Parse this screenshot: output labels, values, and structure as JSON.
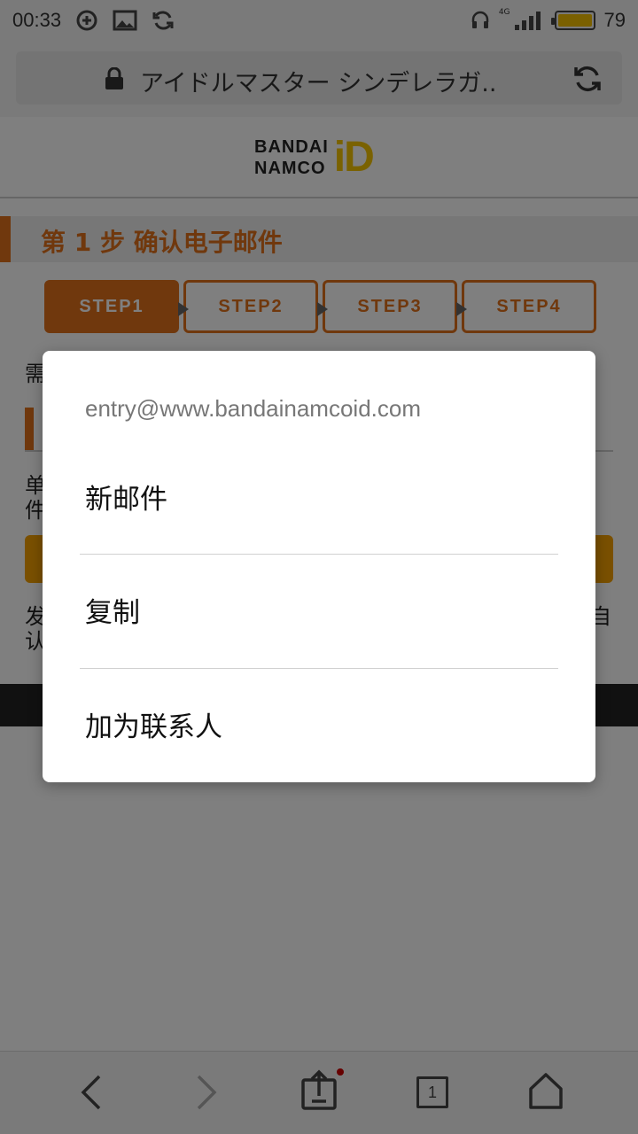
{
  "status_bar": {
    "time": "00:33",
    "network_type": "4G",
    "battery": "79",
    "battery_color": "#f5c000"
  },
  "url_bar": {
    "title": "アイドルマスター シンデレラガ.."
  },
  "logo": {
    "line1": "BANDAI",
    "line2": "NAMCO",
    "mark": "iD",
    "mark_color": "#f5c400"
  },
  "page": {
    "step_heading": "第 1 步 确认电子邮件",
    "accent_color": "#e0701b",
    "steps": [
      {
        "label": "STEP1",
        "active": true
      },
      {
        "label": "STEP2",
        "active": false
      },
      {
        "label": "STEP3",
        "active": false
      },
      {
        "label": "STEP4",
        "active": false
      }
    ],
    "visible_text": {
      "line_a": "需",
      "line_b1": "单",
      "line_b2": "件",
      "line_c1": "发",
      "line_c2": "认",
      "line_c_right": "自"
    }
  },
  "dialog": {
    "header": "entry@www.bandainamcoid.com",
    "items": [
      {
        "label": "新邮件"
      },
      {
        "label": "复制"
      },
      {
        "label": "加为联系人"
      }
    ]
  },
  "bottom_nav": {
    "tab_count": "1"
  }
}
